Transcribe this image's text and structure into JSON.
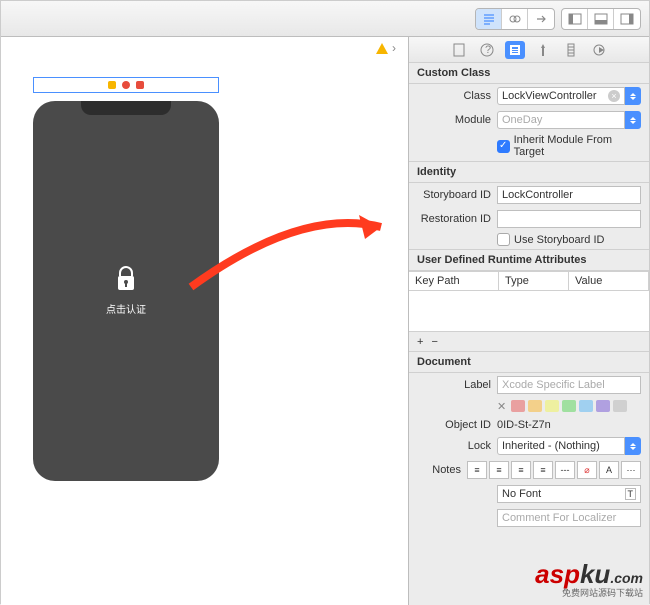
{
  "toolbar": {
    "group1": [
      "lines",
      "link",
      "swap"
    ],
    "group2": [
      "panel-left",
      "panel-bottom",
      "panel-right"
    ]
  },
  "canvas": {
    "sel_dots": [
      "#f7b500",
      "#e74c3c",
      "#e74c3c"
    ],
    "lock_text": "点击认证"
  },
  "sections": {
    "custom": {
      "title": "Custom Class",
      "class_lbl": "Class",
      "class_val": "LockViewController",
      "mod_lbl": "Module",
      "mod_val": "OneDay",
      "inherit": "Inherit Module From Target"
    },
    "identity": {
      "title": "Identity",
      "sb_lbl": "Storyboard ID",
      "sb_val": "LockController",
      "rest_lbl": "Restoration ID",
      "rest_val": "",
      "use_sb": "Use Storyboard ID"
    },
    "udra": {
      "title": "User Defined Runtime Attributes",
      "cols": [
        "Key Path",
        "Type",
        "Value"
      ]
    },
    "doc": {
      "title": "Document",
      "label_lbl": "Label",
      "label_ph": "Xcode Specific Label",
      "oid_lbl": "Object ID",
      "oid_val": "0ID-St-Z7n",
      "lock_lbl": "Lock",
      "lock_val": "Inherited - (Nothing)",
      "notes_lbl": "Notes",
      "font_ph": "No Font",
      "comment_ph": "Comment For Localizer"
    },
    "swatches": [
      "#e9a0a0",
      "#f3d08a",
      "#eef0a0",
      "#a0e0a0",
      "#a0d0f0",
      "#b0a0e0",
      "#d0d0d0"
    ]
  },
  "watermark": {
    "a": "asp",
    "b": "ku",
    "c": ".com",
    "sub": "免费网站源码下载站"
  }
}
